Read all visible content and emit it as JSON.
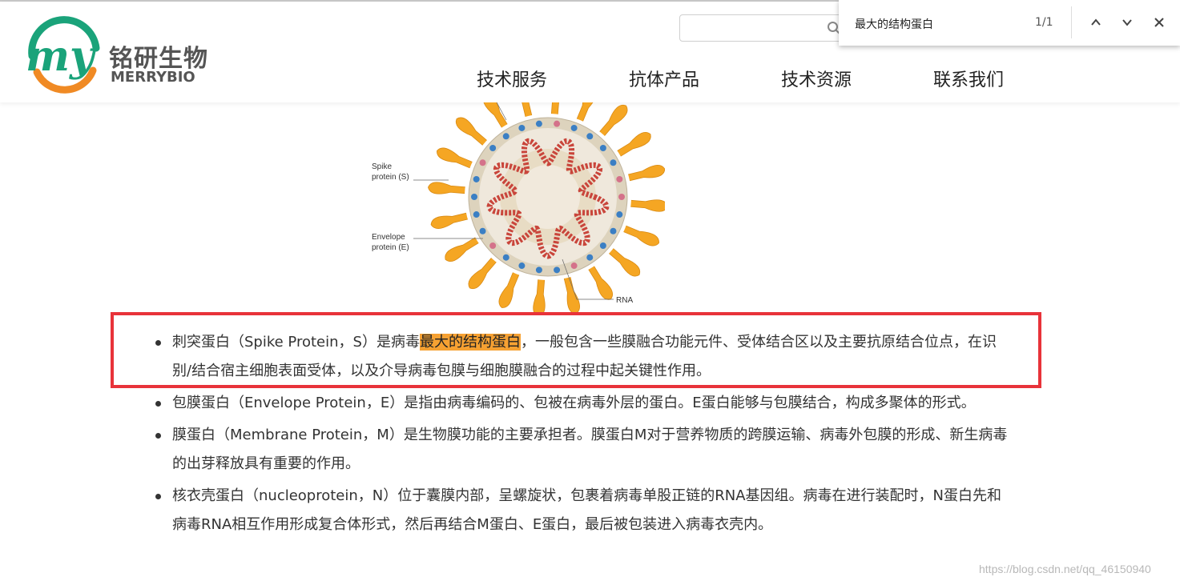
{
  "site": {
    "logo_cn": "铭研生物",
    "logo_en": "MERRYBIO",
    "brand_colors": {
      "teal": "#1aa37a",
      "orange": "#f08a24"
    }
  },
  "nav": {
    "items": [
      {
        "label": "技术服务"
      },
      {
        "label": "抗体产品"
      },
      {
        "label": "技术资源"
      },
      {
        "label": "联系我们"
      }
    ]
  },
  "search": {
    "placeholder": ""
  },
  "find_bar": {
    "query": "最大的结构蛋白",
    "count": "1/1",
    "icons": [
      "chevron-up-icon",
      "chevron-down-icon",
      "close-icon"
    ]
  },
  "figure": {
    "labels": {
      "spike": [
        "Spike",
        "protein (S)"
      ],
      "envelope": [
        "Envelope",
        "protein (E)"
      ],
      "rna": "RNA"
    }
  },
  "content": {
    "items": [
      {
        "before": "刺突蛋白（Spike Protein，S）是病毒",
        "highlight": "最大的结构蛋白",
        "after": "，一般包含一些膜融合功能元件、受体结合区以及主要抗原结合位点，在识别/结合宿主细胞表面受体，以及介导病毒包膜与细胞膜融合的过程中起关键性作用。"
      },
      {
        "text": "包膜蛋白（Envelope Protein，E）是指由病毒编码的、包被在病毒外层的蛋白。E蛋白能够与包膜结合，构成多聚体的形式。"
      },
      {
        "text": "膜蛋白（Membrane Protein，M）是生物膜功能的主要承担者。膜蛋白M对于营养物质的跨膜运输、病毒外包膜的形成、新生病毒的出芽释放具有重要的作用。"
      },
      {
        "text": "核衣壳蛋白（nucleoprotein，N）位于囊膜内部，呈螺旋状，包裹着病毒单股正链的RNA基因组。病毒在进行装配时，N蛋白先和病毒RNA相互作用形成复合体形式，然后再结合M蛋白、E蛋白，最后被包装进入病毒衣壳内。"
      }
    ],
    "highlight_color": "#f6a132",
    "annotation_color": "#e8333a"
  },
  "watermark": "https://blog.csdn.net/qq_46150940"
}
